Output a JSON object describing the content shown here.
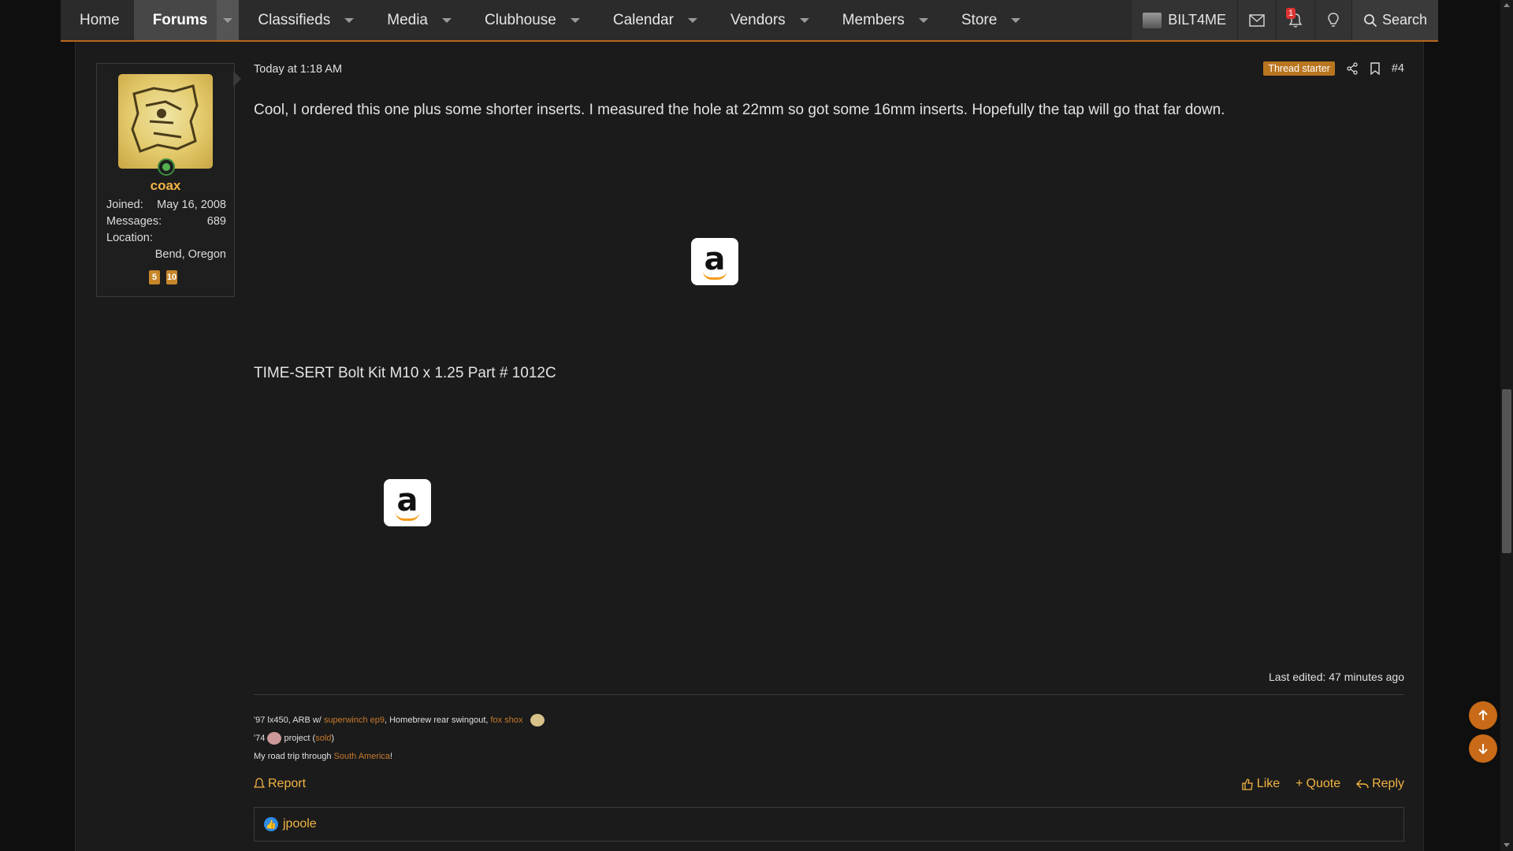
{
  "nav": {
    "items": [
      {
        "label": "Home"
      },
      {
        "label": "Forums"
      },
      {
        "label": "Classifieds"
      },
      {
        "label": "Media"
      },
      {
        "label": "Clubhouse"
      },
      {
        "label": "Calendar"
      },
      {
        "label": "Vendors"
      },
      {
        "label": "Members"
      },
      {
        "label": "Store"
      }
    ],
    "user": "BILT4ME",
    "alerts_count": "1",
    "search_label": "Search"
  },
  "post": {
    "author": {
      "username": "coax",
      "joined_label": "Joined:",
      "joined": "May 16, 2008",
      "messages_label": "Messages:",
      "messages": "689",
      "location_label": "Location:",
      "location": "Bend, Oregon",
      "trophies": [
        "5",
        "10"
      ]
    },
    "date": "Today at 1:18 AM",
    "starter_badge": "Thread starter",
    "number": "#4",
    "text": "Cool, I ordered this one plus some shorter inserts. I measured the hole at 22mm so got some 16mm inserts. Hopefully the tap will go that far down.",
    "product": "TIME-SERT Bolt Kit M10 x 1.25 Part # 1012C",
    "edited": "Last edited: 47 minutes ago",
    "signature": {
      "line1_a": "'97 lx450, ARB w/ ",
      "line1_link1": "superwinch ep9",
      "line1_b": ", Homebrew rear swingout, ",
      "line1_link2": "fox shox",
      "line2_a": "'74 ",
      "line2_b": " project (",
      "line2_link": "sold",
      "line2_c": ")",
      "line3_a": "My road trip through ",
      "line3_link": "South America",
      "line3_b": "!"
    },
    "actions": {
      "report": "Report",
      "like": "Like",
      "quote": "Quote",
      "reply": "Reply"
    },
    "reaction_user": "jpoole"
  },
  "colors": {
    "accent": "#c86a17",
    "username": "#f2b443",
    "link": "#c77a2c"
  }
}
